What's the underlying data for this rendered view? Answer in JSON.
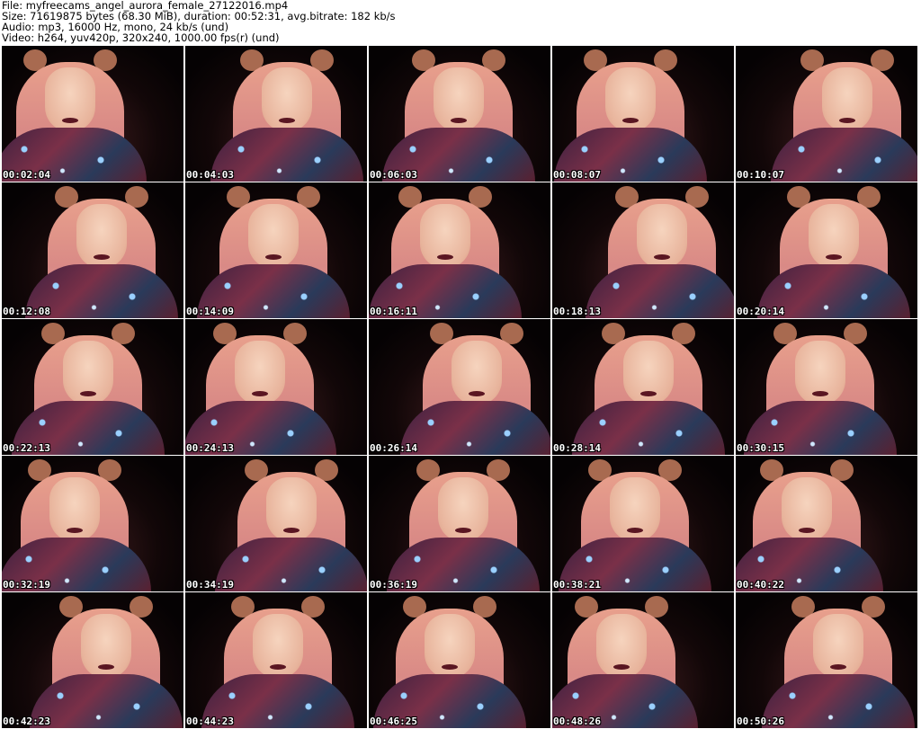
{
  "header": {
    "file": "File: myfreecams_angel_aurora_female_27122016.mp4",
    "size": "Size: 71619875 bytes (68.30 MiB), duration: 00:52:31, avg.bitrate: 182 kb/s",
    "audio": "Audio: mp3, 16000 Hz, mono, 24 kb/s (und)",
    "video": "Video: h264, yuv420p, 320x240, 1000.00 fps(r) (und)"
  },
  "thumbnails": [
    "00:02:04",
    "00:04:03",
    "00:06:03",
    "00:08:07",
    "00:10:07",
    "00:12:08",
    "00:14:09",
    "00:16:11",
    "00:18:13",
    "00:20:14",
    "00:22:13",
    "00:24:13",
    "00:26:14",
    "00:28:14",
    "00:30:15",
    "00:32:19",
    "00:34:19",
    "00:36:19",
    "00:38:21",
    "00:40:22",
    "00:42:23",
    "00:44:23",
    "00:46:25",
    "00:48:26",
    "00:50:26"
  ]
}
